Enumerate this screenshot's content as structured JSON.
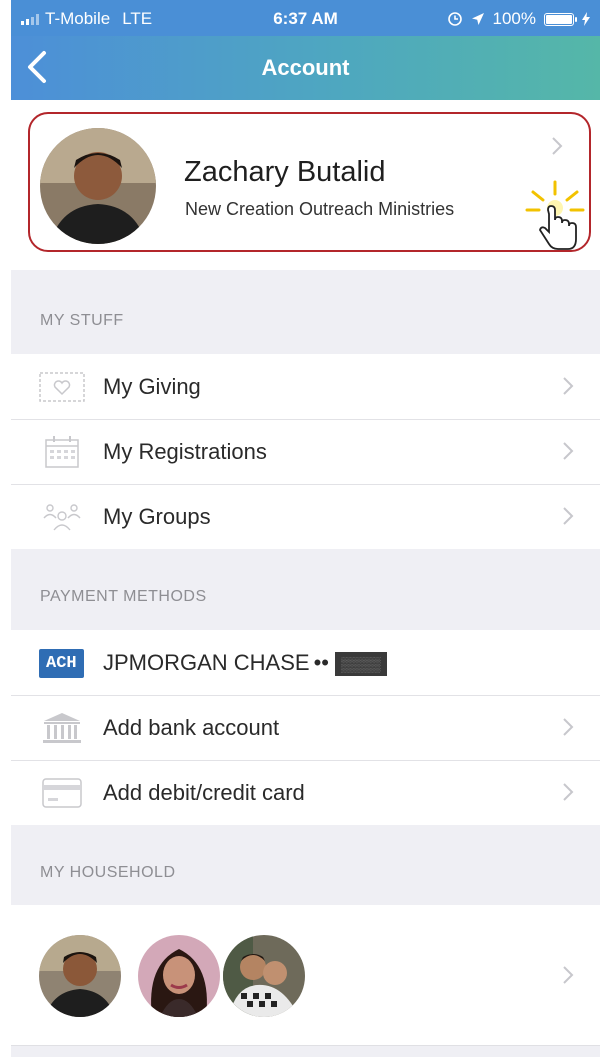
{
  "status_bar": {
    "carrier": "T-Mobile",
    "network": "LTE",
    "time": "6:37 AM",
    "battery": "100%",
    "icons": [
      "signal-icon",
      "alarm-icon",
      "location-icon",
      "battery-icon",
      "charging-icon"
    ]
  },
  "nav": {
    "title": "Account",
    "back_icon": "back-chevron-icon"
  },
  "profile": {
    "name": "Zachary Butalid",
    "organization": "New Creation Outreach Ministries",
    "highlight_color": "#b3262b"
  },
  "my_stuff": {
    "header": "MY STUFF",
    "items": [
      {
        "label": "My Giving",
        "icon": "giving-icon"
      },
      {
        "label": "My Registrations",
        "icon": "calendar-icon"
      },
      {
        "label": "My Groups",
        "icon": "groups-icon"
      }
    ]
  },
  "payment_methods": {
    "header": "PAYMENT METHODS",
    "ach_badge": "ACH",
    "bank_name": "JPMORGAN CHASE",
    "account_dots": "••",
    "account_masked": "▒▒▒▒",
    "items": [
      {
        "label": "Add bank account",
        "icon": "bank-icon"
      },
      {
        "label": "Add debit/credit card",
        "icon": "credit-card-icon"
      }
    ]
  },
  "household": {
    "header": "MY HOUSEHOLD",
    "members": 3
  },
  "colors": {
    "nav_gradient_start": "#4d8fd8",
    "nav_gradient_end": "#55b7a8",
    "ach_badge": "#2f6db4",
    "background": "#efeff4"
  }
}
